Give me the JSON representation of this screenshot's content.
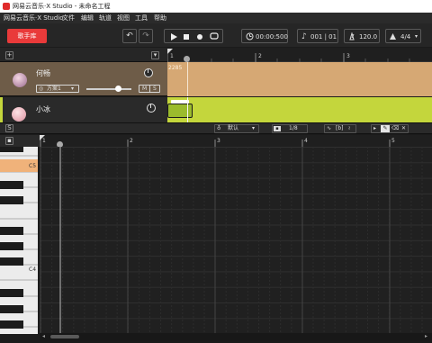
{
  "window": {
    "title": "网易云音乐·X Studio - 未命名工程"
  },
  "menu": [
    "网易云音乐·X Studio",
    "文件",
    "编辑",
    "轨道",
    "视图",
    "工具",
    "帮助"
  ],
  "toolbar": {
    "singer_library_label": "歌手库",
    "time_display": "00:00:500",
    "position_display": "001 | 01",
    "tempo": "120.0",
    "time_signature": "4/4"
  },
  "tracks": [
    {
      "name": "何畅",
      "style": "方案1",
      "solo_label": "S",
      "mute_label": "M",
      "color": "#d6a874"
    },
    {
      "name": "小冰",
      "color": "#c4d63c"
    }
  ],
  "arrangement": {
    "ruler_marks": [
      "1",
      "2",
      "3"
    ],
    "clip_label": "2285"
  },
  "editor": {
    "mode_label": "默认",
    "grid_value": "1/8",
    "param_a": "[b]",
    "lyrics_label": "S"
  },
  "piano_roll": {
    "ruler_marks": [
      "1",
      "2",
      "3",
      "4",
      "5"
    ],
    "key_labels": [
      "C5",
      "C4"
    ]
  },
  "colors": {
    "accent_red": "#e93a3a",
    "track1_bg": "#6e5c48",
    "track1_clip": "#d6a874",
    "track2_clip": "#c4d63c",
    "highlight_key": "#f0b27a"
  }
}
